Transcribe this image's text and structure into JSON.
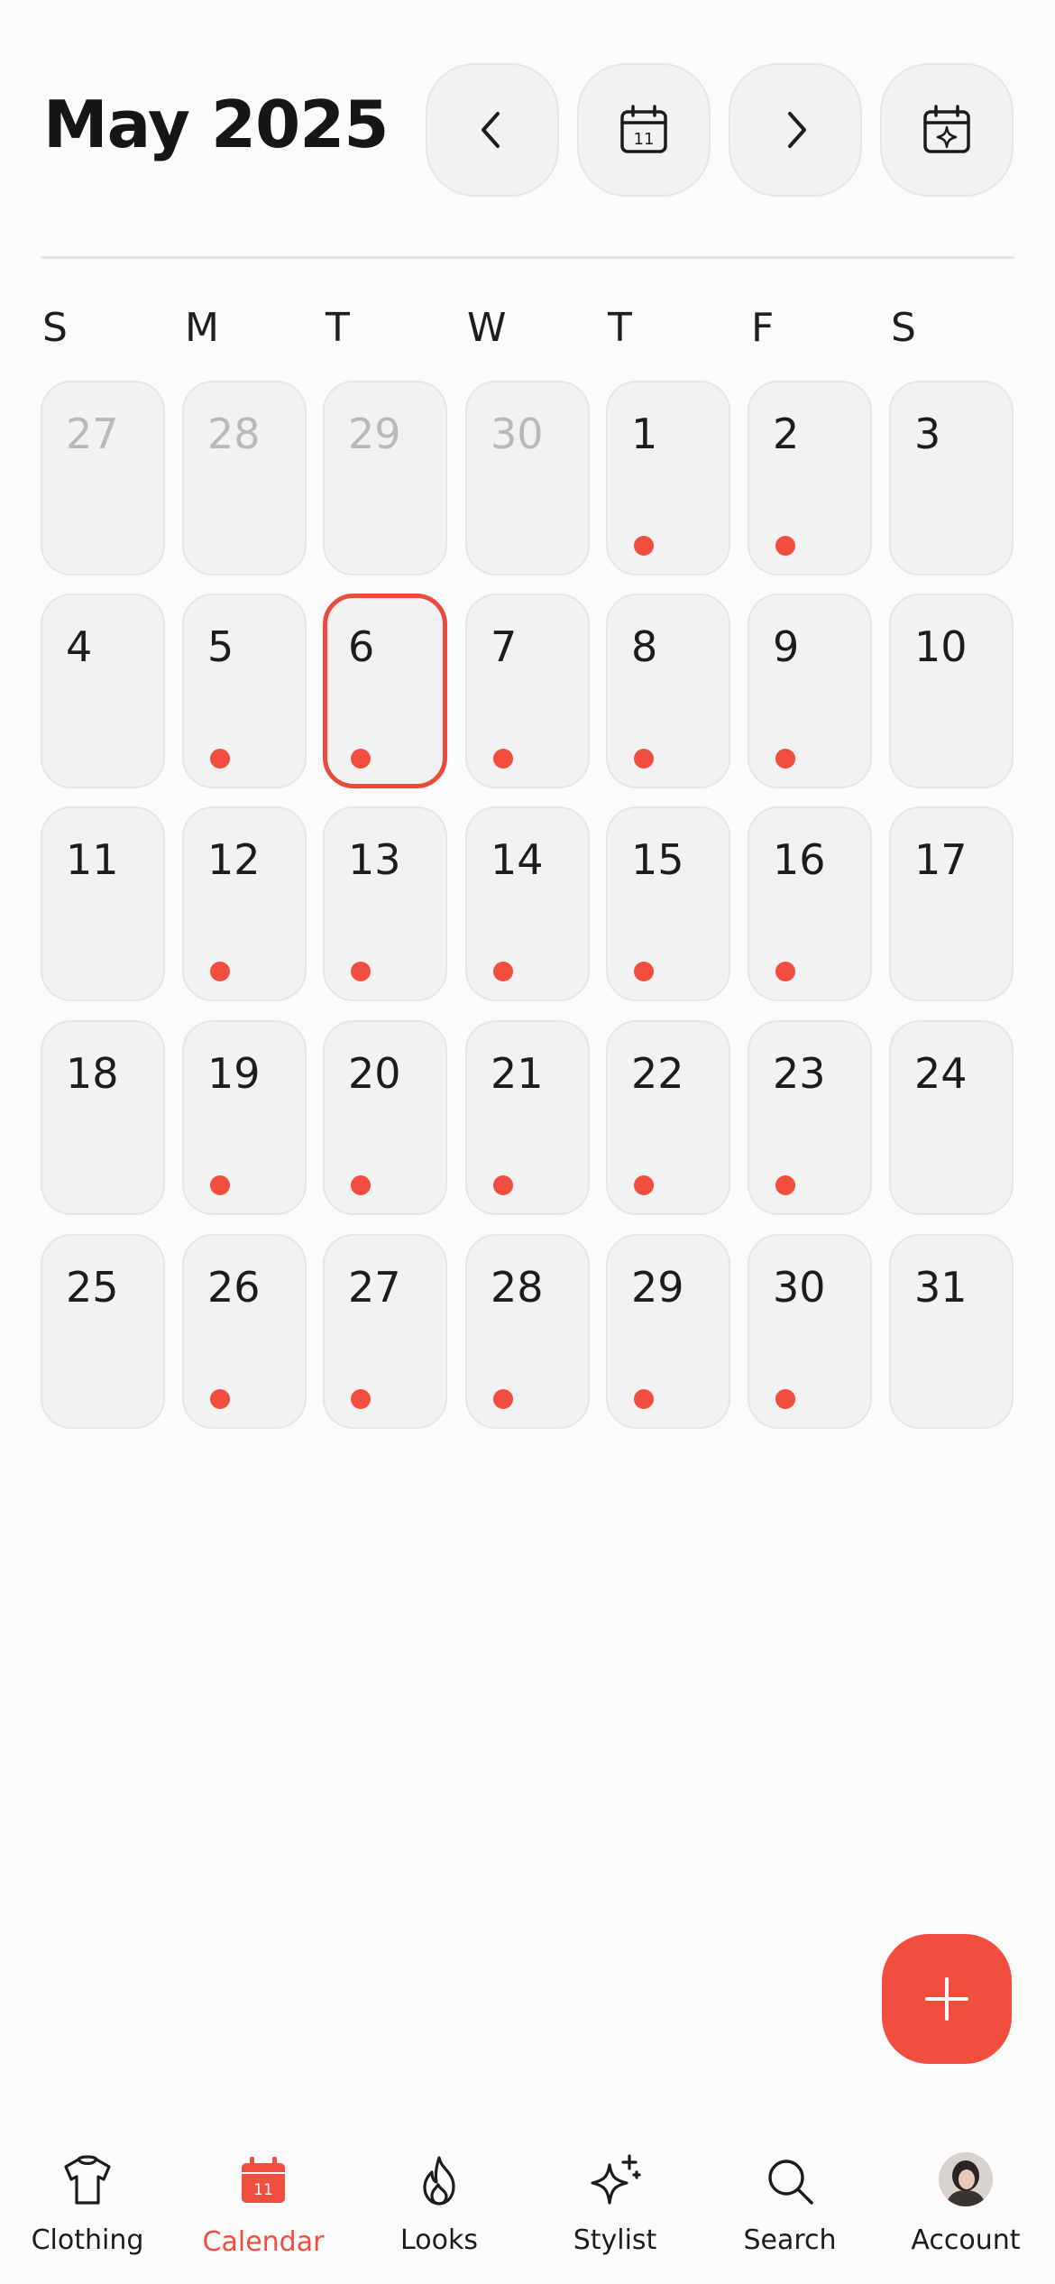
{
  "header": {
    "title": "May 2025"
  },
  "weekdays": [
    "S",
    "M",
    "T",
    "W",
    "T",
    "F",
    "S"
  ],
  "calendar": {
    "days": [
      {
        "label": "27",
        "other": true,
        "dot": false
      },
      {
        "label": "28",
        "other": true,
        "dot": false
      },
      {
        "label": "29",
        "other": true,
        "dot": false
      },
      {
        "label": "30",
        "other": true,
        "dot": false
      },
      {
        "label": "1",
        "other": false,
        "dot": true
      },
      {
        "label": "2",
        "other": false,
        "dot": true
      },
      {
        "label": "3",
        "other": false,
        "dot": false
      },
      {
        "label": "4",
        "other": false,
        "dot": false
      },
      {
        "label": "5",
        "other": false,
        "dot": true
      },
      {
        "label": "6",
        "other": false,
        "dot": true,
        "selected": true
      },
      {
        "label": "7",
        "other": false,
        "dot": true
      },
      {
        "label": "8",
        "other": false,
        "dot": true
      },
      {
        "label": "9",
        "other": false,
        "dot": true
      },
      {
        "label": "10",
        "other": false,
        "dot": false
      },
      {
        "label": "11",
        "other": false,
        "dot": false
      },
      {
        "label": "12",
        "other": false,
        "dot": true
      },
      {
        "label": "13",
        "other": false,
        "dot": true
      },
      {
        "label": "14",
        "other": false,
        "dot": true
      },
      {
        "label": "15",
        "other": false,
        "dot": true
      },
      {
        "label": "16",
        "other": false,
        "dot": true
      },
      {
        "label": "17",
        "other": false,
        "dot": false
      },
      {
        "label": "18",
        "other": false,
        "dot": false
      },
      {
        "label": "19",
        "other": false,
        "dot": true
      },
      {
        "label": "20",
        "other": false,
        "dot": true
      },
      {
        "label": "21",
        "other": false,
        "dot": true
      },
      {
        "label": "22",
        "other": false,
        "dot": true
      },
      {
        "label": "23",
        "other": false,
        "dot": true
      },
      {
        "label": "24",
        "other": false,
        "dot": false
      },
      {
        "label": "25",
        "other": false,
        "dot": false
      },
      {
        "label": "26",
        "other": false,
        "dot": true
      },
      {
        "label": "27",
        "other": false,
        "dot": true
      },
      {
        "label": "28",
        "other": false,
        "dot": true
      },
      {
        "label": "29",
        "other": false,
        "dot": true
      },
      {
        "label": "30",
        "other": false,
        "dot": true
      },
      {
        "label": "31",
        "other": false,
        "dot": false
      }
    ]
  },
  "nav": {
    "items": [
      {
        "label": "Clothing",
        "icon": "shirt-icon",
        "active": false
      },
      {
        "label": "Calendar",
        "icon": "calendar-icon",
        "active": true,
        "icon_text": "11"
      },
      {
        "label": "Looks",
        "icon": "flame-icon",
        "active": false
      },
      {
        "label": "Stylist",
        "icon": "sparkle-icon",
        "active": false
      },
      {
        "label": "Search",
        "icon": "search-icon",
        "active": false
      },
      {
        "label": "Account",
        "icon": "avatar",
        "active": false
      }
    ]
  },
  "today_icon_text": "11",
  "colors": {
    "accent": "#f24e3f",
    "cell_bg": "#f2f2f2",
    "muted_text": "#b9b9b9",
    "page_bg": "#fbfbfb"
  }
}
